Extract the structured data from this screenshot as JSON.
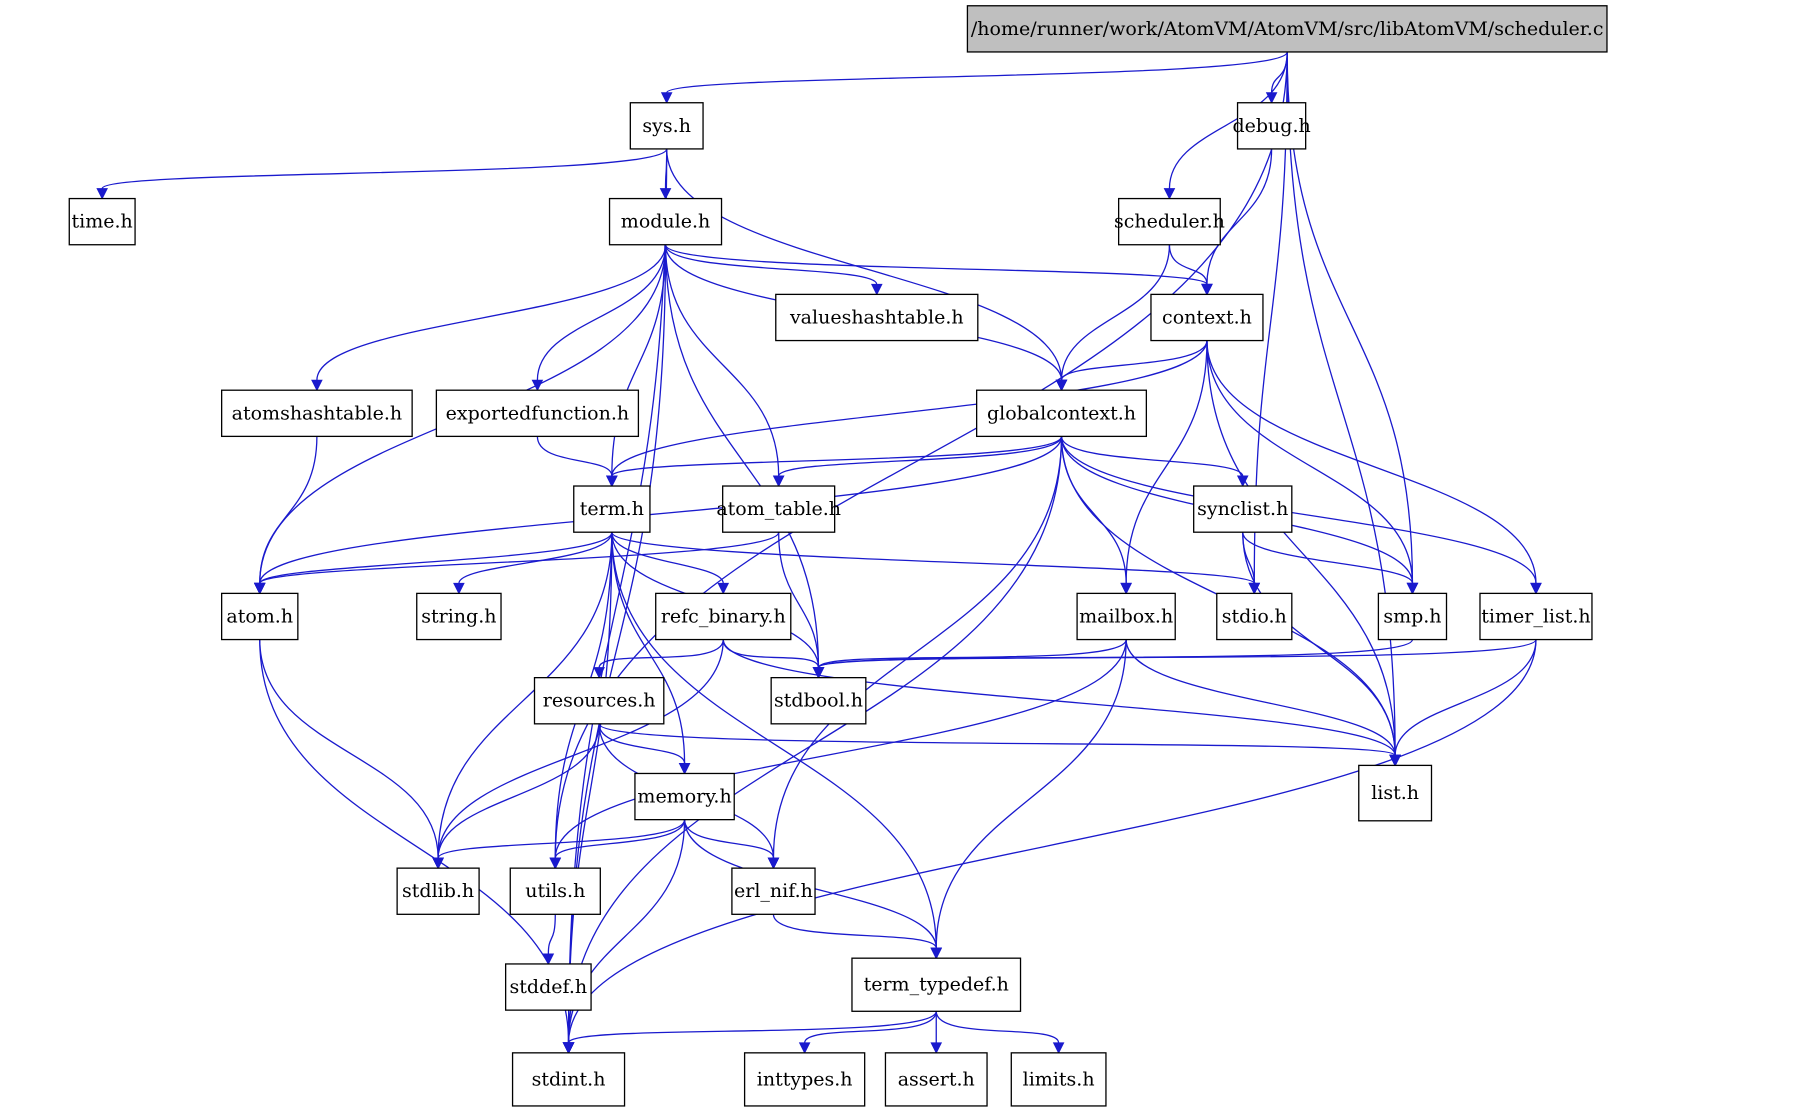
{
  "diagram": {
    "type": "include-dependency-graph",
    "edge_color": "#1a1acd",
    "root_fill": "#bfbfbf",
    "nodes": [
      {
        "id": "root",
        "label": "/home/runner/work/AtomVM/AtomVM/src/libAtomVM/scheduler.c",
        "root": true
      },
      {
        "id": "sys",
        "label": "sys.h"
      },
      {
        "id": "debug",
        "label": "debug.h"
      },
      {
        "id": "time",
        "label": "time.h"
      },
      {
        "id": "module",
        "label": "module.h"
      },
      {
        "id": "scheduler",
        "label": "scheduler.h"
      },
      {
        "id": "valueshashtable",
        "label": "valueshashtable.h"
      },
      {
        "id": "context",
        "label": "context.h"
      },
      {
        "id": "atomshashtable",
        "label": "atomshashtable.h"
      },
      {
        "id": "exportedfunction",
        "label": "exportedfunction.h"
      },
      {
        "id": "globalcontext",
        "label": "globalcontext.h"
      },
      {
        "id": "term",
        "label": "term.h"
      },
      {
        "id": "atom_table",
        "label": "atom_table.h"
      },
      {
        "id": "synclist",
        "label": "synclist.h"
      },
      {
        "id": "atom",
        "label": "atom.h"
      },
      {
        "id": "string",
        "label": "string.h"
      },
      {
        "id": "refc_binary",
        "label": "refc_binary.h"
      },
      {
        "id": "mailbox",
        "label": "mailbox.h"
      },
      {
        "id": "stdio",
        "label": "stdio.h"
      },
      {
        "id": "smp",
        "label": "smp.h"
      },
      {
        "id": "timer_list",
        "label": "timer_list.h"
      },
      {
        "id": "resources",
        "label": "resources.h"
      },
      {
        "id": "stdbool",
        "label": "stdbool.h"
      },
      {
        "id": "memory",
        "label": "memory.h"
      },
      {
        "id": "list",
        "label": "list.h"
      },
      {
        "id": "stdlib",
        "label": "stdlib.h"
      },
      {
        "id": "utils",
        "label": "utils.h"
      },
      {
        "id": "erl_nif",
        "label": "erl_nif.h"
      },
      {
        "id": "stddef",
        "label": "stddef.h"
      },
      {
        "id": "term_typedef",
        "label": "term_typedef.h"
      },
      {
        "id": "stdint",
        "label": "stdint.h"
      },
      {
        "id": "inttypes",
        "label": "inttypes.h"
      },
      {
        "id": "assert",
        "label": "assert.h"
      },
      {
        "id": "limits",
        "label": "limits.h"
      }
    ],
    "edges": [
      [
        "root",
        "sys"
      ],
      [
        "root",
        "debug"
      ],
      [
        "root",
        "scheduler"
      ],
      [
        "root",
        "utils"
      ],
      [
        "root",
        "stdio"
      ],
      [
        "root",
        "smp"
      ],
      [
        "root",
        "list"
      ],
      [
        "sys",
        "time"
      ],
      [
        "sys",
        "module"
      ],
      [
        "sys",
        "globalcontext"
      ],
      [
        "sys",
        "stdint"
      ],
      [
        "debug",
        "context"
      ],
      [
        "scheduler",
        "context"
      ],
      [
        "scheduler",
        "globalcontext"
      ],
      [
        "module",
        "valueshashtable"
      ],
      [
        "module",
        "context"
      ],
      [
        "module",
        "atomshashtable"
      ],
      [
        "module",
        "exportedfunction"
      ],
      [
        "module",
        "globalcontext"
      ],
      [
        "module",
        "term"
      ],
      [
        "module",
        "atom_table"
      ],
      [
        "module",
        "atom"
      ],
      [
        "module",
        "stdbool"
      ],
      [
        "module",
        "stdint"
      ],
      [
        "context",
        "globalcontext"
      ],
      [
        "context",
        "term"
      ],
      [
        "context",
        "mailbox"
      ],
      [
        "context",
        "smp"
      ],
      [
        "context",
        "timer_list"
      ],
      [
        "context",
        "list"
      ],
      [
        "atomshashtable",
        "atom"
      ],
      [
        "exportedfunction",
        "term"
      ],
      [
        "globalcontext",
        "term"
      ],
      [
        "globalcontext",
        "atom_table"
      ],
      [
        "globalcontext",
        "synclist"
      ],
      [
        "globalcontext",
        "atom"
      ],
      [
        "globalcontext",
        "mailbox"
      ],
      [
        "globalcontext",
        "smp"
      ],
      [
        "globalcontext",
        "timer_list"
      ],
      [
        "globalcontext",
        "list"
      ],
      [
        "globalcontext",
        "erl_nif"
      ],
      [
        "globalcontext",
        "stdint"
      ],
      [
        "term",
        "atom"
      ],
      [
        "term",
        "string"
      ],
      [
        "term",
        "refc_binary"
      ],
      [
        "term",
        "stdio"
      ],
      [
        "term",
        "stdbool"
      ],
      [
        "term",
        "memory"
      ],
      [
        "term",
        "stdlib"
      ],
      [
        "term",
        "utils"
      ],
      [
        "term",
        "term_typedef"
      ],
      [
        "term",
        "stdint"
      ],
      [
        "atom_table",
        "atom"
      ],
      [
        "atom_table",
        "stdbool"
      ],
      [
        "synclist",
        "stdio"
      ],
      [
        "synclist",
        "smp"
      ],
      [
        "synclist",
        "list"
      ],
      [
        "atom",
        "stdlib"
      ],
      [
        "atom",
        "stdint"
      ],
      [
        "refc_binary",
        "resources"
      ],
      [
        "refc_binary",
        "stdbool"
      ],
      [
        "refc_binary",
        "stdlib"
      ],
      [
        "refc_binary",
        "list"
      ],
      [
        "mailbox",
        "stdbool"
      ],
      [
        "mailbox",
        "utils"
      ],
      [
        "mailbox",
        "list"
      ],
      [
        "mailbox",
        "term_typedef"
      ],
      [
        "smp",
        "stdbool"
      ],
      [
        "timer_list",
        "stdbool"
      ],
      [
        "timer_list",
        "list"
      ],
      [
        "timer_list",
        "stdint"
      ],
      [
        "resources",
        "memory"
      ],
      [
        "resources",
        "stdlib"
      ],
      [
        "resources",
        "erl_nif"
      ],
      [
        "resources",
        "list"
      ],
      [
        "memory",
        "stdlib"
      ],
      [
        "memory",
        "utils"
      ],
      [
        "memory",
        "erl_nif"
      ],
      [
        "memory",
        "term_typedef"
      ],
      [
        "memory",
        "stdint"
      ],
      [
        "utils",
        "stddef"
      ],
      [
        "erl_nif",
        "term_typedef"
      ],
      [
        "term_typedef",
        "stdint"
      ],
      [
        "term_typedef",
        "inttypes"
      ],
      [
        "term_typedef",
        "assert"
      ],
      [
        "term_typedef",
        "limits"
      ]
    ]
  }
}
